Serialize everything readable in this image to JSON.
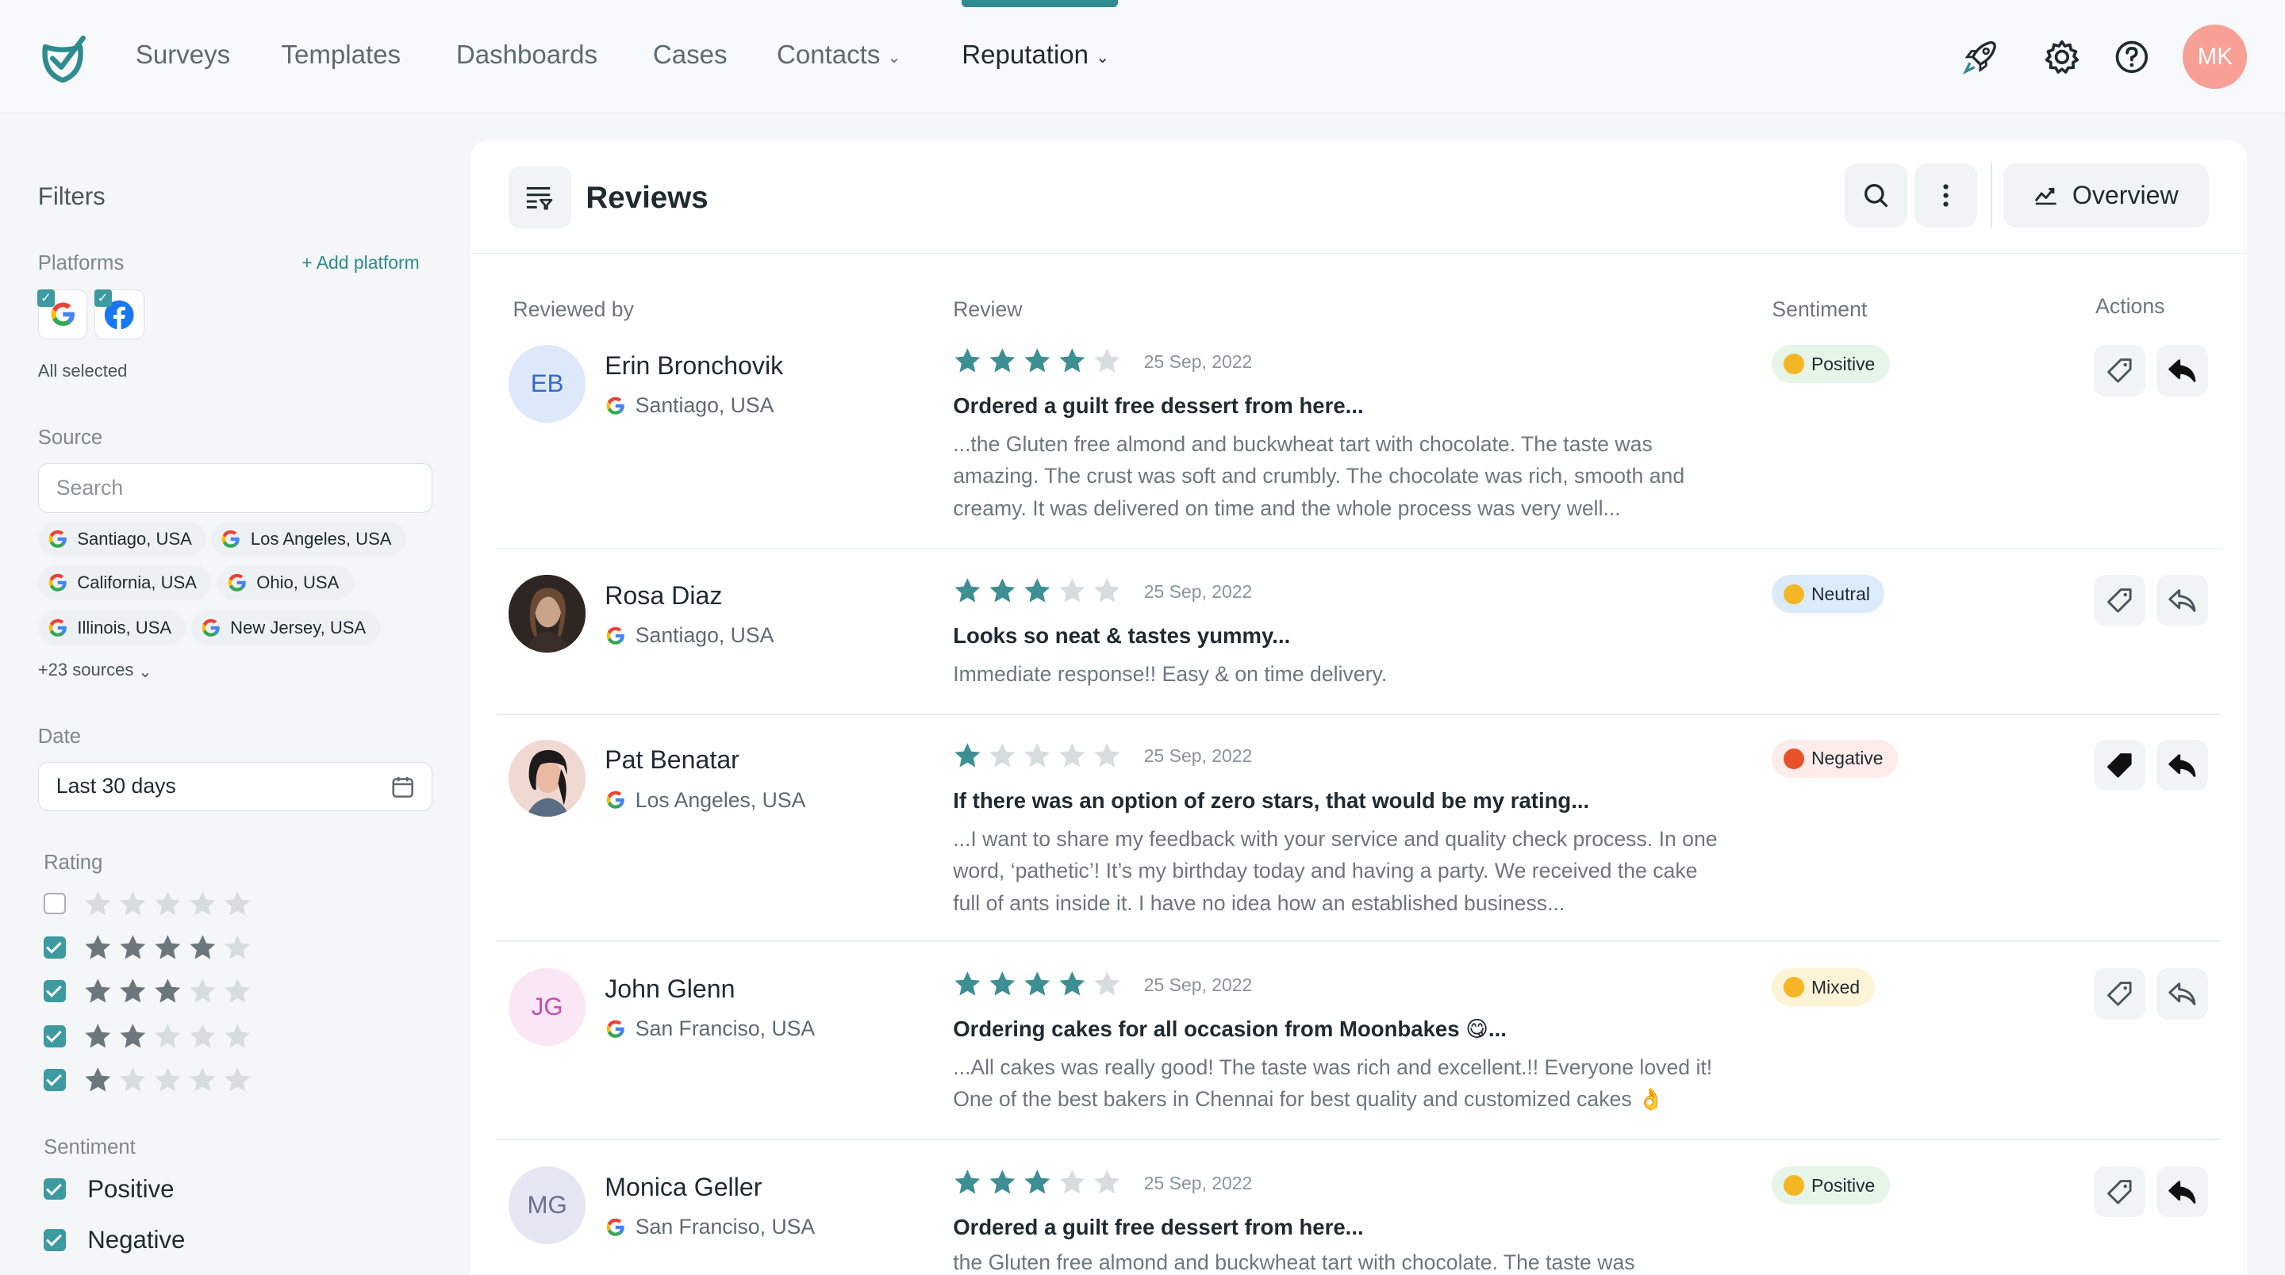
{
  "nav": {
    "items": [
      {
        "label": "Surveys"
      },
      {
        "label": "Templates"
      },
      {
        "label": "Dashboards"
      },
      {
        "label": "Cases"
      },
      {
        "label": "Contacts"
      },
      {
        "label": "Reputation"
      }
    ],
    "active": "Reputation",
    "user_initials": "MK",
    "icons": [
      "rocket-icon",
      "gear-icon",
      "help-icon"
    ]
  },
  "sidebar": {
    "title": "Filters",
    "platforms_label": "Platforms",
    "add_platform": "+ Add platform",
    "platforms": [
      "Google",
      "Facebook"
    ],
    "platforms_status": "All selected",
    "source_label": "Source",
    "source_search_placeholder": "Search",
    "sources": [
      "Santiago, USA",
      "Los Angeles, USA",
      "California, USA",
      "Ohio, USA",
      "Illinois, USA",
      "New Jersey, USA"
    ],
    "more_sources": "+23 sources",
    "date_label": "Date",
    "date_value": "Last 30 days",
    "rating_label": "Rating",
    "ratings": [
      {
        "stars": 5,
        "checked": false
      },
      {
        "stars": 4,
        "checked": true
      },
      {
        "stars": 3,
        "checked": true
      },
      {
        "stars": 2,
        "checked": true
      },
      {
        "stars": 1,
        "checked": true
      }
    ],
    "sentiment_label": "Sentiment",
    "sentiments": [
      {
        "label": "Positive",
        "checked": true
      },
      {
        "label": "Negative",
        "checked": true
      }
    ]
  },
  "main": {
    "title": "Reviews",
    "overview_label": "Overview",
    "columns": {
      "reviewed_by": "Reviewed by",
      "review": "Review",
      "sentiment": "Sentiment",
      "actions": "Actions"
    },
    "reviews": [
      {
        "initials": "EB",
        "name": "Erin Bronchovik",
        "location": "Santiago, USA",
        "rating": 4,
        "date": "25 Sep, 2022",
        "title": "Ordered a guilt free dessert from here...",
        "body": "...the Gluten free almond and buckwheat tart with chocolate. The taste was amazing. The crust was soft and crumbly. The chocolate was rich, smooth and creamy. It was delivered on time and the whole process was very well...",
        "sentiment": "Positive"
      },
      {
        "initials": "",
        "name": "Rosa Diaz",
        "location": "Santiago, USA",
        "rating": 3,
        "date": "25 Sep, 2022",
        "title": "Looks so neat & tastes yummy...",
        "body": "Immediate response!! Easy & on time delivery.",
        "sentiment": "Neutral"
      },
      {
        "initials": "",
        "name": "Pat Benatar",
        "location": "Los Angeles, USA",
        "rating": 1,
        "date": "25 Sep, 2022",
        "title": "If there was an option of zero stars, that would be my rating...",
        "body": "...I want to share my feedback with your service and quality check process. In one word, ‘pathetic’! It’s my birthday today and having a party. We received the cake full of ants inside it. I have no idea how an established business...",
        "sentiment": "Negative"
      },
      {
        "initials": "JG",
        "name": "John Glenn",
        "location": "San Franciso, USA",
        "rating": 4,
        "date": "25 Sep, 2022",
        "title": "Ordering cakes for all occasion from Moonbakes 😋...",
        "body": "...All cakes was really good! The taste was rich and excellent.!!  Everyone loved it! One of the best bakers in Chennai for best quality and customized cakes 👌",
        "sentiment": "Mixed"
      },
      {
        "initials": "MG",
        "name": "Monica Geller",
        "location": "San Franciso, USA",
        "rating": 3,
        "date": "25 Sep, 2022",
        "title": "Ordered a guilt free dessert from here...",
        "body": "the Gluten free almond and buckwheat tart with chocolate. The taste was",
        "sentiment": "Positive"
      }
    ]
  },
  "colors": {
    "accent": "#2e8b8f",
    "star": "#3d8f94",
    "star_empty": "#d7dcdf",
    "avatar_user": "#f8a096"
  }
}
